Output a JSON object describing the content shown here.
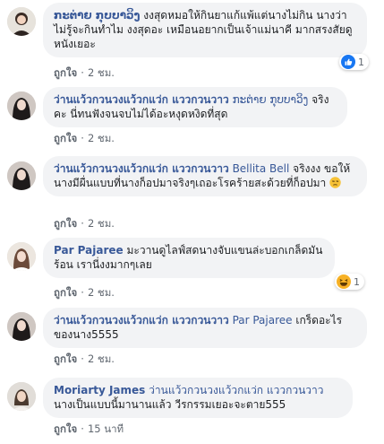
{
  "like_label": "ถูกใจ",
  "separator": "·",
  "comments": [
    {
      "author": "ກະຕ່າຍ ກຸບບາວິງ",
      "tag": "",
      "text": " งงสุดหมอให้กินยาแก้แพ้แต่นางไม่กิน นางว่าไม่รู้จะกินทำไม งงสุดอะ เหมือนอยากเป็นเจ้าแม่นาคี มากสรงสัยดูหนังเยอะ",
      "time": "2 ชม.",
      "reaction": {
        "icon": "thumbs-up-icon",
        "count": "1",
        "color": "#1877f2"
      }
    },
    {
      "author": "ว่านแว้วกวนวงแว้วกแว่ก แววกวนวาว",
      "tag": "ກະຕ່າຍ ກຸບບາວິງ",
      "text": " จริงคะ นี่ทนฟังจนจบไม่ได้อะหงุดหงิดที่สุด",
      "time": "2 ชม."
    },
    {
      "author": "ว่านแว้วกวนวงแว้วกแว่ก แววกวนวาว",
      "tag": "Bellita Bell",
      "text": " จริงงง ขอให้นางมีผื่นแบบที่นางก็อปมาจริงๆเถอะโรคร้ายสะด้วยที่ก็อปมา",
      "time": "2 ชม.",
      "trailing_icon": "unamused-face-icon"
    },
    {
      "author": "Par Pajaree",
      "tag": "",
      "text": " มะวานดูไลฟ์สดนางจับแขนล่ะบอกเกล็ดมันร้อน เรานี่งงมากๆเลย",
      "time": "2 ชม.",
      "reaction": {
        "icon": "laughing-face-icon",
        "count": "1",
        "color": "#f7b125"
      }
    },
    {
      "author": "ว่านแว้วกวนวงแว้วกแว่ก แววกวนวาว",
      "tag": "Par Pajaree",
      "text": " เกร็ดอะไรของนาง5555",
      "time": "2 ชม."
    },
    {
      "author": "Moriarty James",
      "tag": "ว่านแว้วกวนวงแว้วกแว่ก แววกวนวาว",
      "text": " นางเป็นแบบนี้มานานแล้ว วีรกรรมเยอะจะตาย555",
      "time": "15 นาที"
    }
  ]
}
